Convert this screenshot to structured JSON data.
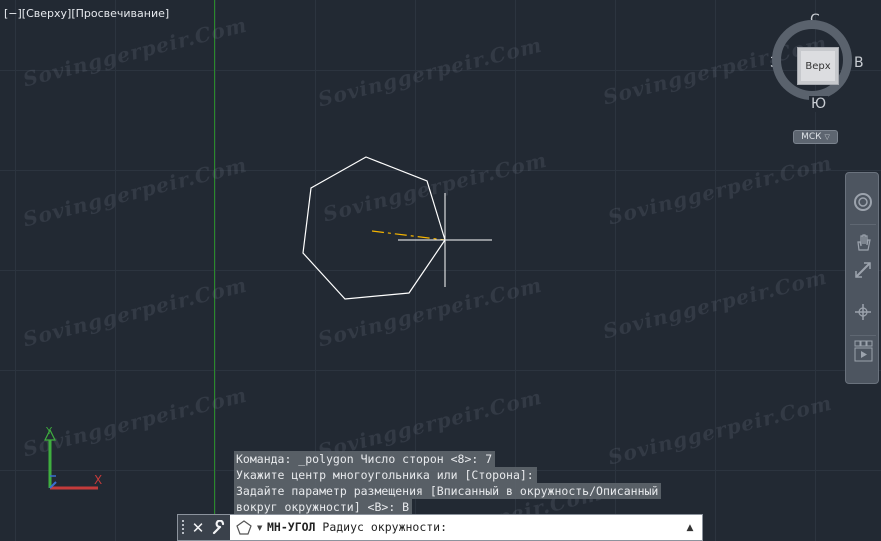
{
  "viewport": {
    "label": "[−][Сверху][Просвечивание]"
  },
  "watermark": {
    "text": "Sovinggerpeir.Com"
  },
  "viewcube": {
    "north": "С",
    "south": "Ю",
    "west": "З",
    "east": "В",
    "face": "Верх",
    "ucs_label": "МСК"
  },
  "navbar": {
    "tools": [
      "full-navigation-wheel-icon",
      "pan-icon",
      "zoom-extents-icon",
      "orbit-icon",
      "showmotion-icon"
    ]
  },
  "ucs_icon": {
    "y_label": "Y",
    "x_label": "X"
  },
  "command_history": [
    "Команда: _polygon Число сторон <8>: 7",
    "Укажите центр многоугольника или [Сторона]:",
    "Задайте параметр размещения [Вписанный в окружность/Описанный",
    "вокруг окружности] <В>: В"
  ],
  "command_line": {
    "command_name": "МН-УГОЛ",
    "prompt": "Радиус окружности:"
  },
  "colors": {
    "background": "#222933",
    "grid_line": "#2c343f",
    "y_axis_line": "#2a8a2a",
    "polygon": "#ffffff",
    "rubber_band": "#f5b400",
    "ucs_x": "#c43b3b",
    "ucs_y": "#3fae3f"
  }
}
